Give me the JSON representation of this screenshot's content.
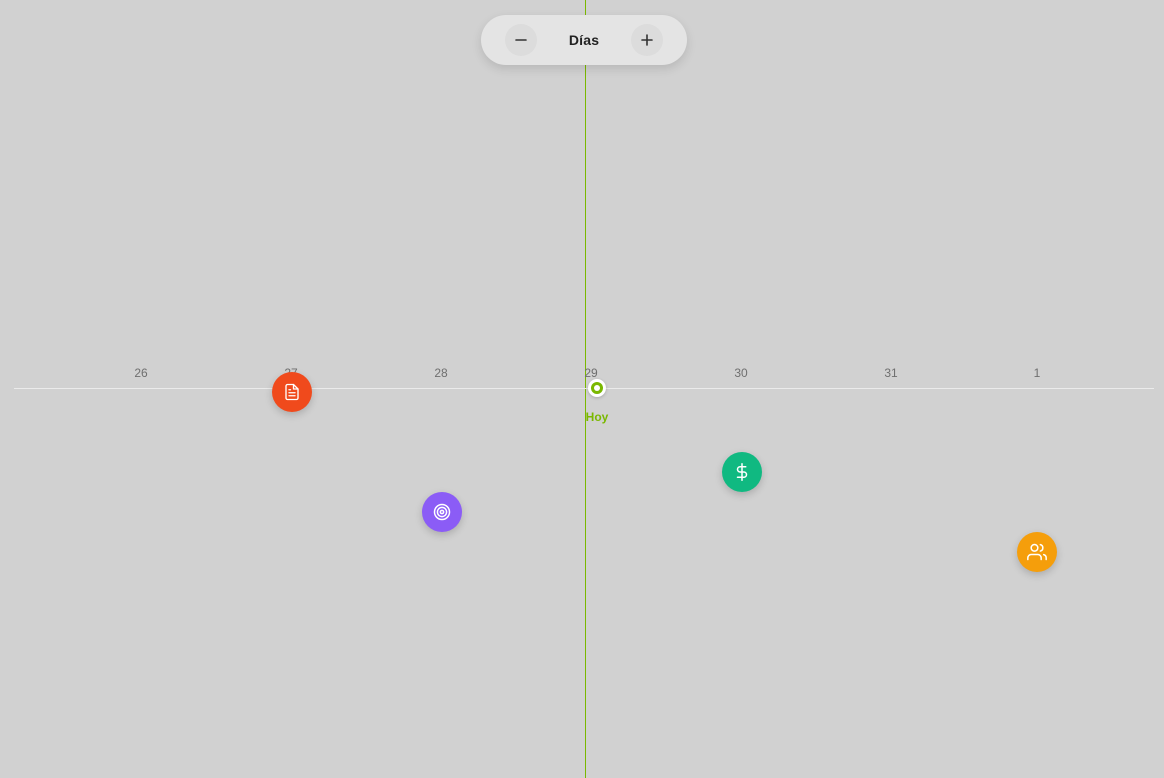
{
  "zoom": {
    "decrease_symbol": "−",
    "label": "Días",
    "increase_symbol": "+"
  },
  "timeline": {
    "ticks": [
      "26",
      "27",
      "28",
      "29",
      "30",
      "31",
      "1"
    ],
    "today_label": "Hoy",
    "today_color": "#7ab800"
  },
  "events": [
    {
      "date": "27",
      "icon": "document-icon",
      "color": "#f04a1c"
    },
    {
      "date": "28",
      "icon": "target-icon",
      "color": "#8b5cf6"
    },
    {
      "date": "30",
      "icon": "dollar-icon",
      "color": "#10b981"
    },
    {
      "date": "1",
      "icon": "users-icon",
      "color": "#f59e0b"
    }
  ]
}
